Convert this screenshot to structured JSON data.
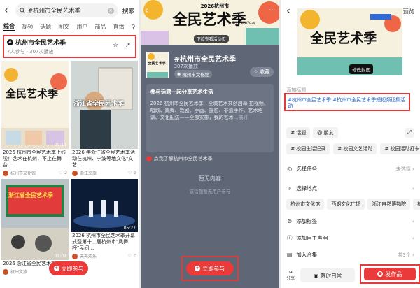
{
  "left": {
    "search_text": "#杭州市全民艺术季",
    "search_button": "搜索",
    "tabs": [
      "综合",
      "视频",
      "话题",
      "图文",
      "用户",
      "商品",
      "直播"
    ],
    "filter_icon": "filter-icon",
    "topic": {
      "title": "杭州市全民艺术季",
      "stats": "7人参与 · 307次播放"
    },
    "cards": [
      {
        "overlay": "全民艺术季",
        "title": "2026 杭州市全民艺术季上线啦！艺术在杭州，不止在舞台…",
        "author": "杭州市文化馆",
        "likes": "2"
      },
      {
        "overlay": "浙江省全民艺术季",
        "title": "2026 年浙江省全民艺术季活动在杭州、宁波等地文化\"文艺…",
        "author": "浙江文旅",
        "likes": "9"
      },
      {
        "overlay": "浙江省全民艺术季",
        "title": "2026 浙江省全民艺术季",
        "author": "杭州文旅",
        "likes": "4"
      },
      {
        "overlay": "",
        "duration": "05:27",
        "title": "2026 杭州市全民艺术季开幕式暨第十二届杭州市\"凤舞杯\"民间…",
        "author": "天天欢乐",
        "likes": "0"
      }
    ],
    "card_durations": [
      "00:13",
      "01:02"
    ],
    "join_button": "立即参与"
  },
  "middle": {
    "banner": {
      "year_city": "2026杭州市",
      "big": "全民艺术季",
      "script": "Art Festival",
      "sub": "下拉查看活动页"
    },
    "thumb_text": "全民艺术季",
    "title": "#杭州市全民艺术季",
    "sub": "307次播放",
    "tag": "杭州市文化馆",
    "fav_button": "收藏",
    "desc_head": "参与话题一起分享艺术生活",
    "desc_body": "2026 杭州市全民艺术季｜全城艺术共创启幕 拍视频、唱歌、跳舞、戏剧、手画、摄影、非遗手作、艺术培训、文化配送——全部安排，我的艺术",
    "desc_more": "…展开",
    "link_text": "点我了解杭州市全民艺术季",
    "empty_title": "暂无内容",
    "empty_sub": "该话题暂无用户参与",
    "join_button": "立即参与"
  },
  "right": {
    "preview": "预览",
    "cover_text": "全民艺术季",
    "edit_cover": "修改封面",
    "title_placeholder": "添加标题",
    "tags": "#杭州市全民艺术季 #杭州市全民艺术季短视频征集活动",
    "chips": [
      "# 话题",
      "@ 朋友"
    ],
    "chips2": [
      "# 校园生活记录",
      "# 校园文艺活动",
      "# 校园活动打卡"
    ],
    "rows": [
      {
        "icon": "task-icon",
        "label": "选择任务",
        "right": "未选择 ›"
      },
      {
        "icon": "location-icon",
        "label": "选择地点",
        "right": "›"
      },
      {
        "icon": "tag-icon",
        "label": "添加标签",
        "right": "›"
      },
      {
        "icon": "statement-icon",
        "label": "添加自主声明",
        "right": "›"
      },
      {
        "icon": "collection-icon",
        "label": "加入合集",
        "right": "共3个 ›"
      }
    ],
    "locations": [
      "杭州市文化馆",
      "西湖文化广场",
      "浙江自然博物院",
      "杭"
    ],
    "share": "分享",
    "draft": "限时日常",
    "publish": "发作品"
  }
}
